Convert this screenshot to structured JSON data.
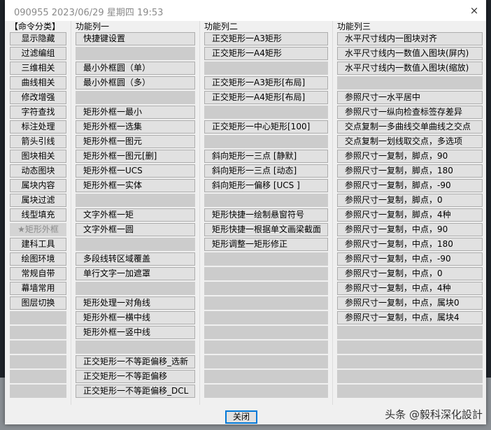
{
  "window": {
    "title": "090955 2023/06/29 星期四 19:53",
    "close_icon": "×"
  },
  "categories": {
    "header": "【命令分类】",
    "selected": "★矩形外框",
    "items": [
      "显示隐藏",
      "过滤编组",
      "三维相关",
      "曲线相关",
      "修改增强",
      "字符查找",
      "标注处理",
      "箭头引线",
      "图块相关",
      "动态图块",
      "属块内容",
      "属块过滤",
      "线型填充",
      "★矩形外框",
      "建科工具",
      "绘图环境",
      "常规自带",
      "幕墙常用",
      "图层切换",
      "",
      "",
      "",
      "",
      "",
      ""
    ]
  },
  "col1": {
    "header": "功能列一",
    "items": [
      "快捷键设置",
      "",
      "最小外框圆（单）",
      "最小外框圆（多）",
      "",
      "矩形外框一最小",
      "矩形外框一选集",
      "矩形外框一图元",
      "矩形外框一图元[删]",
      "矩形外框一UCS",
      "矩形外框一实体",
      "",
      "文字外框一矩",
      "文字外框一圆",
      "",
      "多段线转区域覆盖",
      "单行文字一加遮罩",
      "",
      "矩形处理一对角线",
      "矩形外框一横中线",
      "矩形外框一竖中线",
      "",
      "正交矩形一不等距偏移_选新",
      "正交矩形一不等距偏移",
      "正交矩形一不等距偏移_DCL"
    ]
  },
  "col2": {
    "header": "功能列二",
    "items": [
      "正交矩形一A3矩形",
      "正交矩形一A4矩形",
      "",
      "正交矩形一A3矩形[布局]",
      "正交矩形一A4矩形[布局]",
      "",
      "正交矩形一中心矩形[100]",
      "",
      "斜向矩形一三点 [静默]",
      "斜向矩形一三点 [动态]",
      "斜向矩形一偏移 [UCS ]",
      "",
      "矩形快捷一绘制悬窗符号",
      "矩形快捷一根据单文画梁截面",
      "矩形调整一矩形修正",
      "",
      "",
      "",
      "",
      "",
      "",
      "",
      "",
      "",
      ""
    ]
  },
  "col3": {
    "header": "功能列三",
    "items": [
      "水平尺寸线内一图块对齐",
      "水平尺寸线内一数值入图块(屏内)",
      "水平尺寸线内一数值入图块(缩放)",
      "",
      "参照尺寸一水平居中",
      "参照尺寸一纵向检查标签存差异",
      "交点复制一多曲线交单曲线之交点",
      "交点复制一划线取交点，多选项",
      "参照尺寸一复制，脚点，90",
      "参照尺寸一复制，脚点，180",
      "参照尺寸一复制，脚点，-90",
      "参照尺寸一复制，脚点，0",
      "参照尺寸一复制，脚点，4种",
      "参照尺寸一复制，中点，90",
      "参照尺寸一复制，中点，180",
      "参照尺寸一复制，中点，-90",
      "参照尺寸一复制，中点，0",
      "参照尺寸一复制，中点，4种",
      "参照尺寸一复制，中点，属块0",
      "参照尺寸一复制，中点，属块4",
      "",
      "",
      "",
      "",
      ""
    ]
  },
  "footer": {
    "close_label": "关闭",
    "watermark": "头条 @毅科深化設計"
  }
}
